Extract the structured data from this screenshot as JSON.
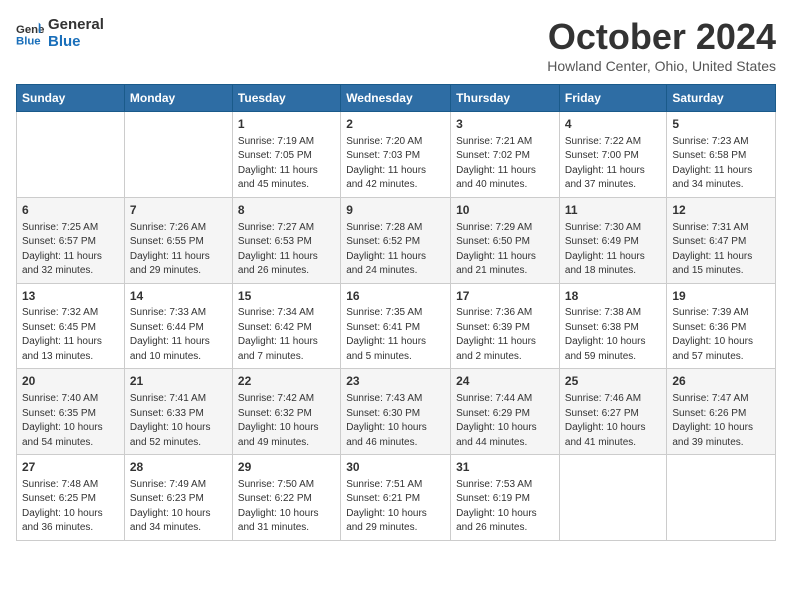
{
  "header": {
    "logo_line1": "General",
    "logo_line2": "Blue",
    "month": "October 2024",
    "location": "Howland Center, Ohio, United States"
  },
  "days_of_week": [
    "Sunday",
    "Monday",
    "Tuesday",
    "Wednesday",
    "Thursday",
    "Friday",
    "Saturday"
  ],
  "weeks": [
    [
      {
        "day": "",
        "content": ""
      },
      {
        "day": "",
        "content": ""
      },
      {
        "day": "1",
        "content": "Sunrise: 7:19 AM\nSunset: 7:05 PM\nDaylight: 11 hours and 45 minutes."
      },
      {
        "day": "2",
        "content": "Sunrise: 7:20 AM\nSunset: 7:03 PM\nDaylight: 11 hours and 42 minutes."
      },
      {
        "day": "3",
        "content": "Sunrise: 7:21 AM\nSunset: 7:02 PM\nDaylight: 11 hours and 40 minutes."
      },
      {
        "day": "4",
        "content": "Sunrise: 7:22 AM\nSunset: 7:00 PM\nDaylight: 11 hours and 37 minutes."
      },
      {
        "day": "5",
        "content": "Sunrise: 7:23 AM\nSunset: 6:58 PM\nDaylight: 11 hours and 34 minutes."
      }
    ],
    [
      {
        "day": "6",
        "content": "Sunrise: 7:25 AM\nSunset: 6:57 PM\nDaylight: 11 hours and 32 minutes."
      },
      {
        "day": "7",
        "content": "Sunrise: 7:26 AM\nSunset: 6:55 PM\nDaylight: 11 hours and 29 minutes."
      },
      {
        "day": "8",
        "content": "Sunrise: 7:27 AM\nSunset: 6:53 PM\nDaylight: 11 hours and 26 minutes."
      },
      {
        "day": "9",
        "content": "Sunrise: 7:28 AM\nSunset: 6:52 PM\nDaylight: 11 hours and 24 minutes."
      },
      {
        "day": "10",
        "content": "Sunrise: 7:29 AM\nSunset: 6:50 PM\nDaylight: 11 hours and 21 minutes."
      },
      {
        "day": "11",
        "content": "Sunrise: 7:30 AM\nSunset: 6:49 PM\nDaylight: 11 hours and 18 minutes."
      },
      {
        "day": "12",
        "content": "Sunrise: 7:31 AM\nSunset: 6:47 PM\nDaylight: 11 hours and 15 minutes."
      }
    ],
    [
      {
        "day": "13",
        "content": "Sunrise: 7:32 AM\nSunset: 6:45 PM\nDaylight: 11 hours and 13 minutes."
      },
      {
        "day": "14",
        "content": "Sunrise: 7:33 AM\nSunset: 6:44 PM\nDaylight: 11 hours and 10 minutes."
      },
      {
        "day": "15",
        "content": "Sunrise: 7:34 AM\nSunset: 6:42 PM\nDaylight: 11 hours and 7 minutes."
      },
      {
        "day": "16",
        "content": "Sunrise: 7:35 AM\nSunset: 6:41 PM\nDaylight: 11 hours and 5 minutes."
      },
      {
        "day": "17",
        "content": "Sunrise: 7:36 AM\nSunset: 6:39 PM\nDaylight: 11 hours and 2 minutes."
      },
      {
        "day": "18",
        "content": "Sunrise: 7:38 AM\nSunset: 6:38 PM\nDaylight: 10 hours and 59 minutes."
      },
      {
        "day": "19",
        "content": "Sunrise: 7:39 AM\nSunset: 6:36 PM\nDaylight: 10 hours and 57 minutes."
      }
    ],
    [
      {
        "day": "20",
        "content": "Sunrise: 7:40 AM\nSunset: 6:35 PM\nDaylight: 10 hours and 54 minutes."
      },
      {
        "day": "21",
        "content": "Sunrise: 7:41 AM\nSunset: 6:33 PM\nDaylight: 10 hours and 52 minutes."
      },
      {
        "day": "22",
        "content": "Sunrise: 7:42 AM\nSunset: 6:32 PM\nDaylight: 10 hours and 49 minutes."
      },
      {
        "day": "23",
        "content": "Sunrise: 7:43 AM\nSunset: 6:30 PM\nDaylight: 10 hours and 46 minutes."
      },
      {
        "day": "24",
        "content": "Sunrise: 7:44 AM\nSunset: 6:29 PM\nDaylight: 10 hours and 44 minutes."
      },
      {
        "day": "25",
        "content": "Sunrise: 7:46 AM\nSunset: 6:27 PM\nDaylight: 10 hours and 41 minutes."
      },
      {
        "day": "26",
        "content": "Sunrise: 7:47 AM\nSunset: 6:26 PM\nDaylight: 10 hours and 39 minutes."
      }
    ],
    [
      {
        "day": "27",
        "content": "Sunrise: 7:48 AM\nSunset: 6:25 PM\nDaylight: 10 hours and 36 minutes."
      },
      {
        "day": "28",
        "content": "Sunrise: 7:49 AM\nSunset: 6:23 PM\nDaylight: 10 hours and 34 minutes."
      },
      {
        "day": "29",
        "content": "Sunrise: 7:50 AM\nSunset: 6:22 PM\nDaylight: 10 hours and 31 minutes."
      },
      {
        "day": "30",
        "content": "Sunrise: 7:51 AM\nSunset: 6:21 PM\nDaylight: 10 hours and 29 minutes."
      },
      {
        "day": "31",
        "content": "Sunrise: 7:53 AM\nSunset: 6:19 PM\nDaylight: 10 hours and 26 minutes."
      },
      {
        "day": "",
        "content": ""
      },
      {
        "day": "",
        "content": ""
      }
    ]
  ]
}
